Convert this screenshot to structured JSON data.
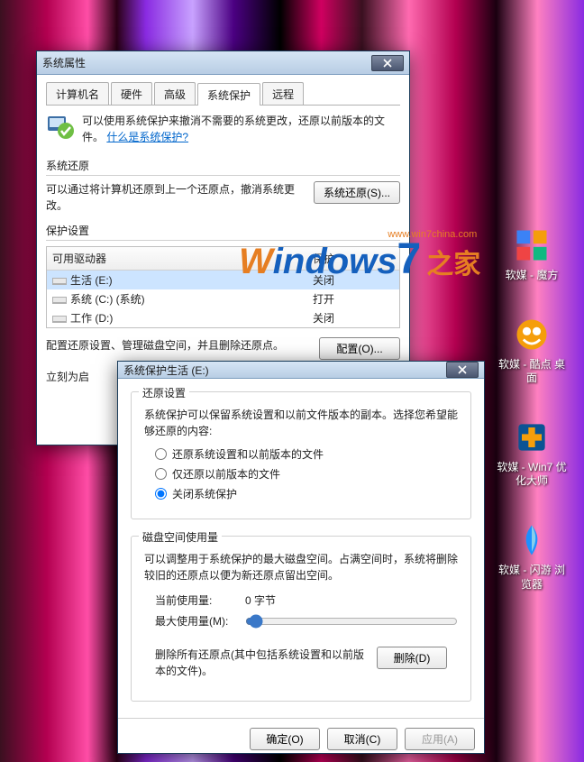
{
  "desktop_icons": [
    {
      "label": "软媒 - 魔方"
    },
    {
      "label": "软媒 - 酷点\n桌面"
    },
    {
      "label": "软媒 - Win7\n优化大师"
    },
    {
      "label": "软媒 - 闪游\n浏览器"
    }
  ],
  "watermark": {
    "url": "www.win7china.com",
    "text1": "W",
    "text2": "indows",
    "text3": "7",
    "text4": "之家"
  },
  "dlg1": {
    "title": "系统属性",
    "tabs": [
      "计算机名",
      "硬件",
      "高级",
      "系统保护",
      "远程"
    ],
    "active_tab": 3,
    "info_text": "可以使用系统保护来撤消不需要的系统更改，还原以前版本的文件。",
    "info_link": "什么是系统保护?",
    "section_restore": "系统还原",
    "restore_desc": "可以通过将计算机还原到上一个还原点，撤消系统更改。",
    "restore_btn": "系统还原(S)...",
    "section_protect": "保护设置",
    "col_drive": "可用驱动器",
    "col_status": "保护",
    "drives": [
      {
        "name": "生活 (E:)",
        "status": "关闭"
      },
      {
        "name": "系统 (C:) (系统)",
        "status": "打开"
      },
      {
        "name": "工作 (D:)",
        "status": "关闭"
      }
    ],
    "config_desc": "配置还原设置、管理磁盘空间，并且删除还原点。",
    "config_btn": "配置(O)...",
    "create_desc": "立刻为启"
  },
  "dlg2": {
    "title": "系统保护生活 (E:)",
    "grp1": "还原设置",
    "grp1_desc": "系统保护可以保留系统设置和以前文件版本的副本。选择您希望能够还原的内容:",
    "opt1": "还原系统设置和以前版本的文件",
    "opt2": "仅还原以前版本的文件",
    "opt3": "关闭系统保护",
    "grp2": "磁盘空间使用量",
    "grp2_desc": "可以调整用于系统保护的最大磁盘空间。占满空间时，系统将删除较旧的还原点以便为新还原点留出空间。",
    "cur_label": "当前使用量:",
    "cur_value": "0 字节",
    "max_label": "最大使用量(M):",
    "del_desc": "删除所有还原点(其中包括系统设置和以前版本的文件)。",
    "del_btn": "删除(D)",
    "ok": "确定(O)",
    "cancel": "取消(C)",
    "apply": "应用(A)"
  }
}
